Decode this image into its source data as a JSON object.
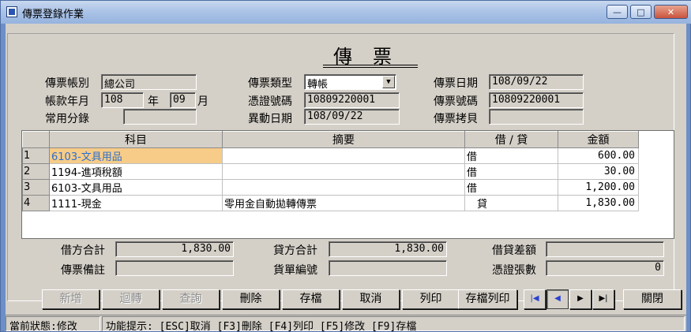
{
  "window": {
    "title": "傳票登錄作業",
    "min_glyph": "—",
    "max_glyph": "□",
    "close_glyph": "✕"
  },
  "header": {
    "title": "傳票"
  },
  "fields": {
    "account_type": {
      "label": "傳票帳別",
      "value": "總公司"
    },
    "account_year": {
      "label": "帳款年月",
      "year": "108",
      "year_unit": "年",
      "month": "09",
      "month_unit": "月"
    },
    "common_entry": {
      "label": "常用分錄",
      "value": ""
    },
    "voucher_type": {
      "label": "傳票類型",
      "value": "轉帳"
    },
    "proof_number": {
      "label": "憑證號碼",
      "value": "10809220001"
    },
    "change_date": {
      "label": "異動日期",
      "value": "108/09/22"
    },
    "voucher_date": {
      "label": "傳票日期",
      "value": "108/09/22"
    },
    "voucher_number": {
      "label": "傳票號碼",
      "value": "10809220001"
    },
    "voucher_copy": {
      "label": "傳票拷貝",
      "value": ""
    }
  },
  "grid": {
    "columns": [
      "科目",
      "摘要",
      "借 / 貸",
      "金額"
    ],
    "rows": [
      {
        "no": "1",
        "account": "6103-文具用品",
        "summary": "",
        "dc": "借",
        "amount": "600.00"
      },
      {
        "no": "2",
        "account": "1194-進項稅額",
        "summary": "",
        "dc": "借",
        "amount": "30.00"
      },
      {
        "no": "3",
        "account": "6103-文具用品",
        "summary": "",
        "dc": "借",
        "amount": "1,200.00"
      },
      {
        "no": "4",
        "account": "1111-現金",
        "summary": "零用金自動拋轉傳票",
        "dc": "　貸",
        "amount": "1,830.00"
      }
    ]
  },
  "totals": {
    "debit_total": {
      "label": "借方合計",
      "value": "1,830.00"
    },
    "credit_total": {
      "label": "貸方合計",
      "value": "1,830.00"
    },
    "difference": {
      "label": "借貸差額",
      "value": ""
    },
    "voucher_note": {
      "label": "傳票備註",
      "value": ""
    },
    "bill_number": {
      "label": "貨單編號",
      "value": ""
    },
    "proof_count": {
      "label": "憑證張數",
      "value": "0"
    }
  },
  "buttons": {
    "add": "新增",
    "reverse": "迴轉",
    "query": "查詢",
    "delete": "刪除",
    "save": "存檔",
    "cancel": "取消",
    "print": "列印",
    "save_print": "存檔列印",
    "close": "關閉"
  },
  "nav": {
    "first_icon": "first-record-icon",
    "prev_icon": "previous-record-icon",
    "next_icon": "next-record-icon",
    "last_icon": "last-record-icon"
  },
  "status": {
    "state": "當前狀態:修改",
    "hint": "功能提示: [ESC]取消 [F3]刪除 [F4]列印 [F5]修改 [F9]存檔"
  },
  "colors": {
    "selected_cell": "#f7cc88",
    "selected_text": "#2b6fcf",
    "nav_arrow": "#2a3fd1"
  }
}
